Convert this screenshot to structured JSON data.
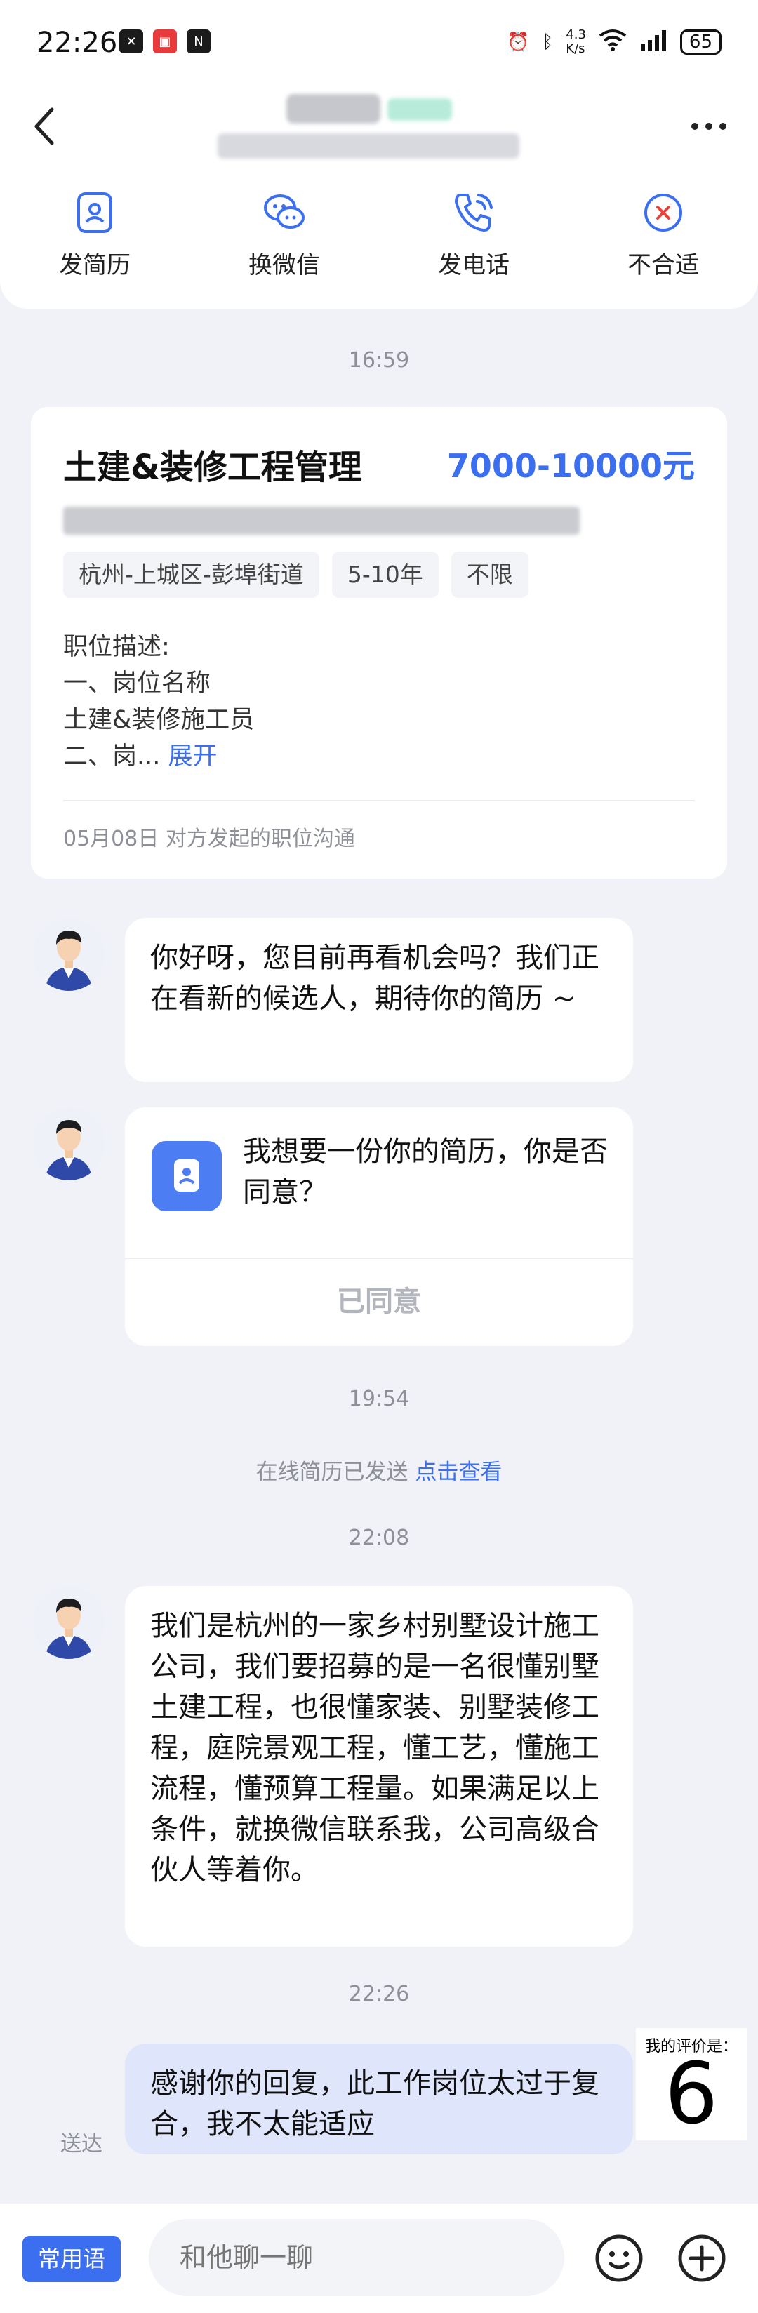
{
  "status": {
    "time": "22:26",
    "speed_top": "4.3",
    "speed_bottom": "K/s",
    "battery": "65"
  },
  "header": {
    "actions": [
      {
        "label": "发简历",
        "icon": "resume-icon"
      },
      {
        "label": "换微信",
        "icon": "wechat-icon"
      },
      {
        "label": "发电话",
        "icon": "phone-icon"
      },
      {
        "label": "不合适",
        "icon": "reject-icon"
      }
    ]
  },
  "timestamps": {
    "t1": "16:59",
    "t2": "19:54",
    "t3": "22:08",
    "t4": "22:26"
  },
  "job": {
    "title": "土建&装修工程管理",
    "salary": "7000-10000元",
    "tags": [
      "杭州-上城区-彭埠街道",
      "5-10年",
      "不限"
    ],
    "desc_label": "职位描述:",
    "desc_line1": "一、岗位名称",
    "desc_line2": "土建&装修施工员",
    "desc_line3": "二、岗...",
    "expand": "展开",
    "footer": "05月08日 对方发起的职位沟通"
  },
  "messages": {
    "m1": "你好呀，您目前再看机会吗？我们正在看新的候选人，期待你的简历 ~",
    "request": "我想要一份你的简历，你是否同意？",
    "agreed": "已同意",
    "sent_note": "在线简历已发送",
    "sent_link": "点击查看",
    "m3": "我们是杭州的一家乡村别墅设计施工公司，我们要招募的是一名很懂别墅土建工程，也很懂家装、别墅装修工程，庭院景观工程，懂工艺，懂施工流程，懂预算工程量。如果满足以上条件，就换微信联系我，公司高级合伙人等着你。",
    "me": "感谢你的回复，此工作岗位太过于复合，我不太能适应",
    "delivered": "送达"
  },
  "rating": {
    "label": "我的评价是：",
    "value": "6"
  },
  "bottom": {
    "phrases": "常用语",
    "placeholder": "和他聊一聊"
  }
}
